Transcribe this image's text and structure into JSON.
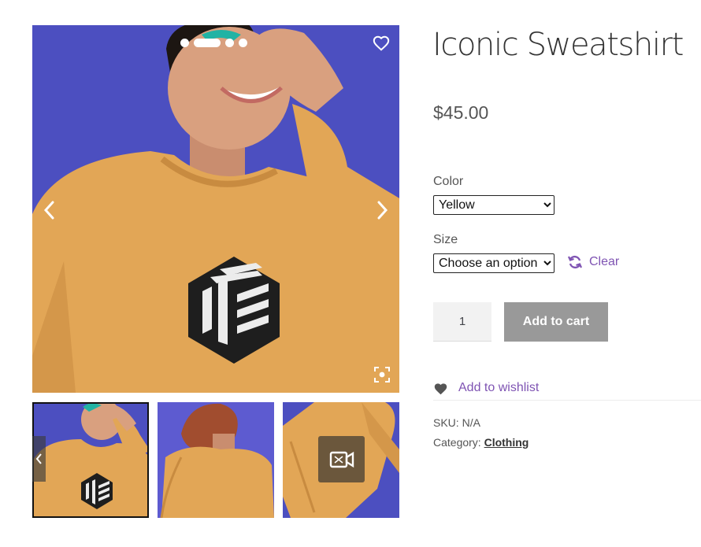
{
  "product": {
    "title": "Iconic Sweatshirt",
    "price": "$45.00"
  },
  "gallery": {
    "slide_count": 4,
    "active_slide": 2,
    "thumbnails": [
      "front view",
      "back view",
      "flat lay video"
    ],
    "background_color": "#4c4fc0",
    "garment_color": "#e2a656"
  },
  "variations": {
    "color_label": "Color",
    "color_value": "Yellow",
    "size_label": "Size",
    "size_value": "Choose an option",
    "clear_label": "Clear"
  },
  "cart": {
    "quantity": "1",
    "add_label": "Add to cart"
  },
  "wishlist": {
    "label": "Add to wishlist"
  },
  "meta": {
    "sku_label": "SKU:",
    "sku_value": "N/A",
    "category_label": "Category:",
    "category_value": "Clothing"
  },
  "colors": {
    "accent": "#7f54b3",
    "button_disabled": "#999999"
  },
  "icons": [
    "heart-icon",
    "chevron-left-icon",
    "chevron-right-icon",
    "zoom-icon",
    "refresh-icon",
    "video-icon"
  ]
}
